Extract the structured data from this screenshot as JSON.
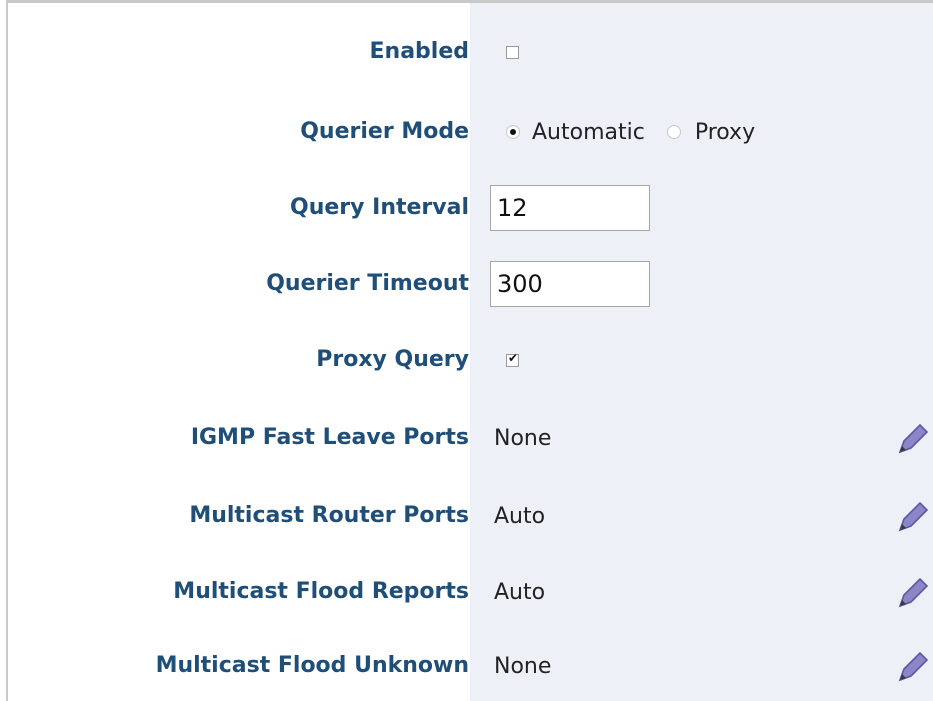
{
  "settings": {
    "enabled": {
      "label": "Enabled",
      "checked": false
    },
    "querier_mode": {
      "label": "Querier Mode",
      "options": [
        "Automatic",
        "Proxy"
      ],
      "selected": "Automatic"
    },
    "query_interval": {
      "label": "Query Interval",
      "value": "12"
    },
    "querier_timeout": {
      "label": "Querier Timeout",
      "value": "300"
    },
    "proxy_query": {
      "label": "Proxy Query",
      "checked": true
    },
    "igmp_fast_leave_ports": {
      "label": "IGMP Fast Leave Ports",
      "value": "None",
      "icon": "edit-pencil-icon"
    },
    "multicast_router_ports": {
      "label": "Multicast Router Ports",
      "value": "Auto",
      "icon": "edit-pencil-icon"
    },
    "multicast_flood_reports": {
      "label": "Multicast Flood Reports",
      "value": "Auto",
      "icon": "edit-pencil-icon"
    },
    "multicast_flood_unknown": {
      "label": "Multicast Flood Unknown",
      "value": "None",
      "icon": "edit-pencil-icon"
    }
  }
}
